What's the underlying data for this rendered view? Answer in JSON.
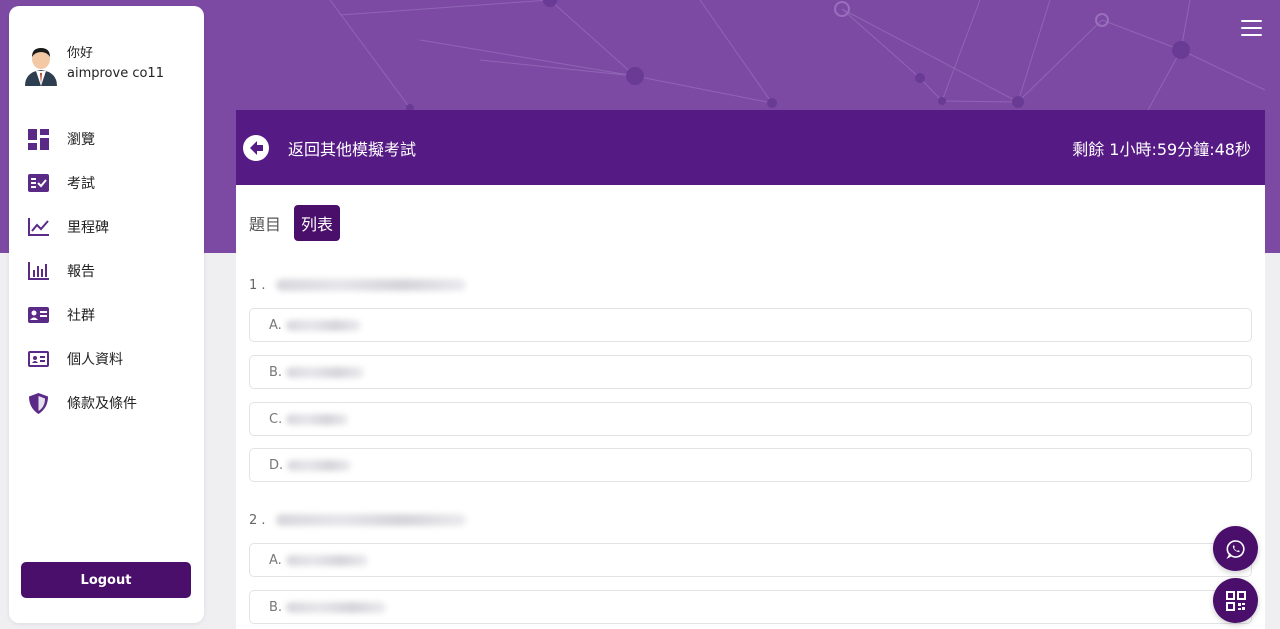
{
  "user": {
    "greeting": "你好",
    "name": "aimprove co11"
  },
  "nav": {
    "items": [
      {
        "label": "瀏覽",
        "icon": "dashboard-icon"
      },
      {
        "label": "考試",
        "icon": "exam-icon"
      },
      {
        "label": "里程碑",
        "icon": "chart-line-icon"
      },
      {
        "label": "報告",
        "icon": "bar-chart-icon"
      },
      {
        "label": "社群",
        "icon": "community-icon"
      },
      {
        "label": "個人資料",
        "icon": "id-card-icon"
      },
      {
        "label": "條款及條件",
        "icon": "shield-icon"
      }
    ],
    "logout_label": "Logout"
  },
  "exam": {
    "back_label": "返回其他模擬考試",
    "timer": "剩餘 1小時:59分鐘:48秒"
  },
  "tabs": {
    "question_label": "題目",
    "list_label": "列表"
  },
  "questions": [
    {
      "number": "1 .",
      "options": [
        "A.",
        "B.",
        "C.",
        "D."
      ]
    },
    {
      "number": "2 .",
      "options": [
        "A.",
        "B."
      ]
    }
  ],
  "colors": {
    "primary": "#4a0f6b",
    "header": "#561a85",
    "hero": "#7c4aa3"
  }
}
